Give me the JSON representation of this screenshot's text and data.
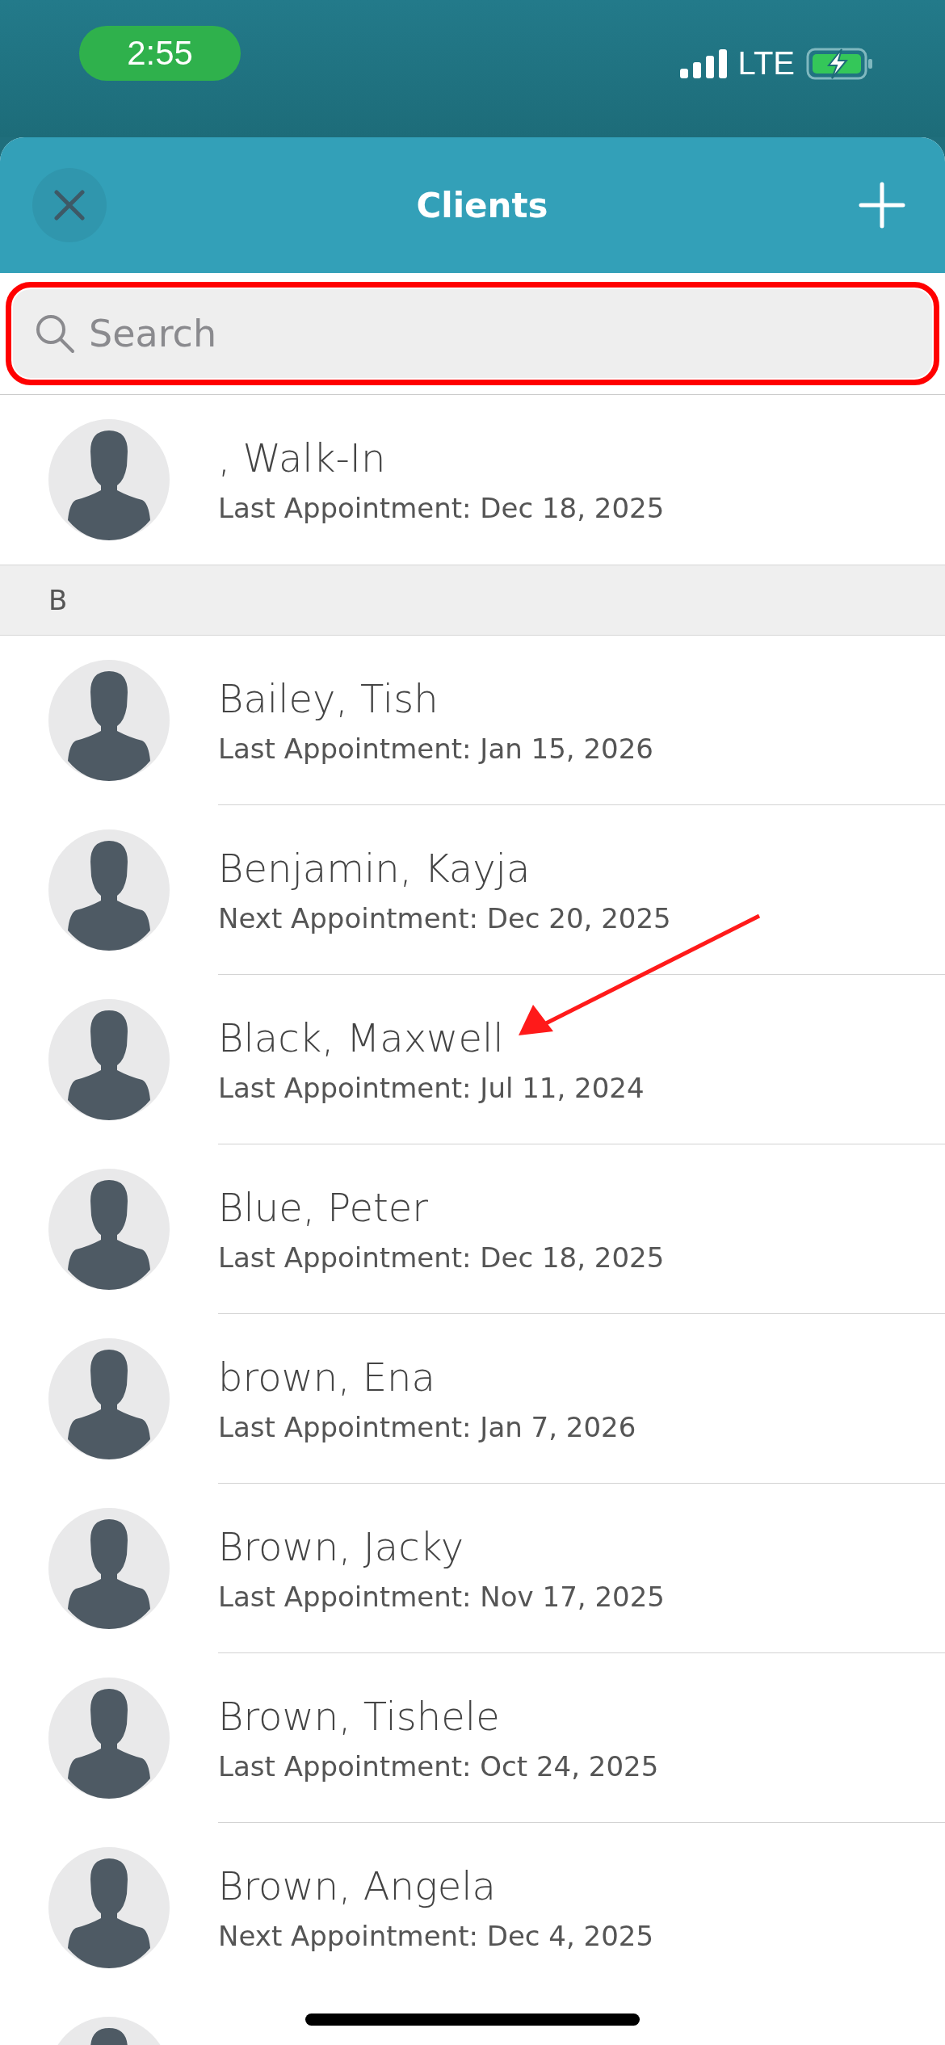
{
  "status_bar": {
    "time": "2:55",
    "network": "LTE"
  },
  "header": {
    "title": "Clients"
  },
  "search": {
    "placeholder": "Search",
    "highlighted": true
  },
  "sections": [
    {
      "rows": [
        {
          "name": ", Walk-In",
          "appointment": "Last Appointment: Dec 18, 2025",
          "pointed": false
        }
      ]
    },
    {
      "letter": "B",
      "rows": [
        {
          "name": "Bailey, Tish",
          "appointment": "Last Appointment: Jan 15, 2026",
          "pointed": false
        },
        {
          "name": "Benjamin, Kayja",
          "appointment": "Next Appointment: Dec 20, 2025",
          "pointed": false
        },
        {
          "name": "Black, Maxwell",
          "appointment": "Last Appointment: Jul 11, 2024",
          "pointed": true
        },
        {
          "name": "Blue, Peter",
          "appointment": "Last Appointment: Dec 18, 2025",
          "pointed": false
        },
        {
          "name": "brown, Ena",
          "appointment": "Last Appointment: Jan 7, 2026",
          "pointed": false
        },
        {
          "name": "Brown, Jacky",
          "appointment": "Last Appointment: Nov 17, 2025",
          "pointed": false
        },
        {
          "name": "Brown, Tishele",
          "appointment": "Last Appointment: Oct 24, 2025",
          "pointed": false
        },
        {
          "name": "Brown, Angela",
          "appointment": "Next Appointment: Dec 4, 2025",
          "pointed": false
        }
      ]
    }
  ]
}
